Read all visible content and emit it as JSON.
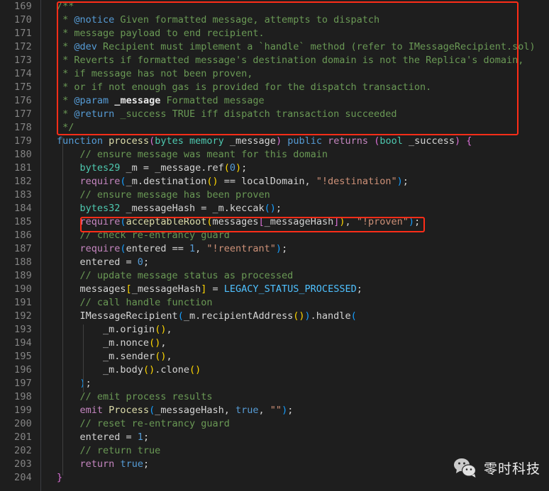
{
  "editor": {
    "language": "solidity",
    "background_color": "#1e1e1e",
    "gutter_color": "#858585",
    "annotation_color": "#ff2d18",
    "first_line_number": 169,
    "last_line_number": 204
  },
  "line_numbers": [
    "169",
    "170",
    "171",
    "172",
    "173",
    "174",
    "175",
    "176",
    "177",
    "178",
    "179",
    "180",
    "181",
    "182",
    "183",
    "184",
    "185",
    "186",
    "187",
    "188",
    "189",
    "190",
    "191",
    "192",
    "193",
    "194",
    "195",
    "196",
    "197",
    "198",
    "199",
    "200",
    "201",
    "202",
    "203",
    "204"
  ],
  "code_lines": [
    "    /**",
    "     * @notice Given formatted message, attempts to dispatch",
    "     * message payload to end recipient.",
    "     * @dev Recipient must implement a `handle` method (refer to IMessageRecipient.sol)",
    "     * Reverts if formatted message's destination domain is not the Replica's domain,",
    "     * if message has not been proven,",
    "     * or if not enough gas is provided for the dispatch transaction.",
    "     * @param _message Formatted message",
    "     * @return _success TRUE iff dispatch transaction succeeded",
    "     */",
    "    function process(bytes memory _message) public returns (bool _success) {",
    "        // ensure message was meant for this domain",
    "        bytes29 _m = _message.ref(0);",
    "        require(_m.destination() == localDomain, \"!destination\");",
    "        // ensure message has been proven",
    "        bytes32 _messageHash = _m.keccak();",
    "        require(acceptableRoot(messages[_messageHash]), \"!proven\");",
    "        // check re-entrancy guard",
    "        require(entered == 1, \"!reentrant\");",
    "        entered = 0;",
    "        // update message status as processed",
    "        messages[_messageHash] = LEGACY_STATUS_PROCESSED;",
    "        // call handle function",
    "        IMessageRecipient(_m.recipientAddress()).handle(",
    "            _m.origin(),",
    "            _m.nonce(),",
    "            _m.sender(),",
    "            _m.body().clone()",
    "        );",
    "        // emit process results",
    "        emit Process(_messageHash, true, \"\");",
    "        // reset re-entrancy guard",
    "        entered = 1;",
    "        // return true",
    "        return true;",
    "    }"
  ],
  "annotations": [
    {
      "name": "natspec-doc-block-highlight",
      "lines": "169-178",
      "color": "#ff2d18"
    },
    {
      "name": "acceptable-root-require-highlight",
      "lines": "185",
      "color": "#ff2d18"
    }
  ],
  "watermark": {
    "icon": "wechat-icon",
    "text": "零时科技"
  }
}
